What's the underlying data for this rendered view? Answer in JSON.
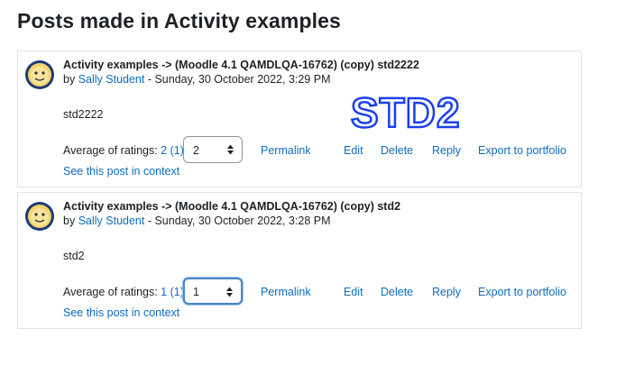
{
  "page": {
    "title": "Posts made in Activity examples"
  },
  "posts": [
    {
      "subject": "Activity examples -> (Moodle 4.1 QAMDLQA-16762) (copy) std2222",
      "by_prefix": "by ",
      "author": "Sally Student",
      "date": " - Sunday, 30 October 2022, 3:29 PM",
      "message": "std2222",
      "rating_label": "Average of ratings: ",
      "rating_value": "2 (1)",
      "select_value": "2",
      "actions": {
        "permalink": "Permalink",
        "edit": "Edit",
        "delete": "Delete",
        "reply": "Reply",
        "export": "Export to portfolio"
      },
      "context_link": "See this post in context"
    },
    {
      "subject": "Activity examples -> (Moodle 4.1 QAMDLQA-16762) (copy) std2",
      "by_prefix": "by ",
      "author": "Sally Student",
      "date": " - Sunday, 30 October 2022, 3:28 PM",
      "message": "std2",
      "rating_label": "Average of ratings: ",
      "rating_value": "1 (1)",
      "select_value": "1",
      "actions": {
        "permalink": "Permalink",
        "edit": "Edit",
        "delete": "Delete",
        "reply": "Reply",
        "export": "Export to portfolio"
      },
      "context_link": "See this post in context"
    }
  ],
  "overlay": {
    "text": "STD2"
  },
  "colors": {
    "link": "#0f6cbf",
    "overlay_stroke": "#1a3ff0",
    "focus": "#4b86c4"
  }
}
